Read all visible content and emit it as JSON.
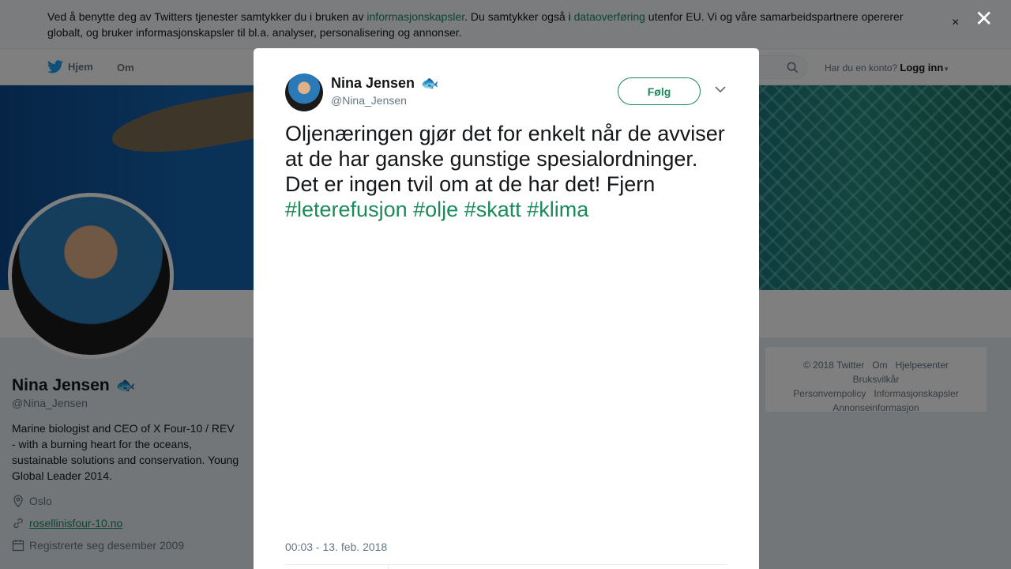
{
  "cookie": {
    "text_1": "Ved å benytte deg av Twitters tjenester samtykker du i bruken av ",
    "link_1": "informasjonskapsler",
    "text_2": ". Du samtykker også i ",
    "link_2": "dataoverføring",
    "text_3": " utenfor EU. Vi og våre samarbeidspartnere opererer globalt, og bruker informasjonskapsler til bl.a. analyser, personalisering og annonser.",
    "close": "×"
  },
  "nav": {
    "home": "Hjem",
    "about": "Om",
    "login_prompt": "Har du en konto?",
    "login": "Logg inn"
  },
  "profile": {
    "name": "Nina Jensen",
    "emoji": "🐟",
    "handle": "@Nina_Jensen",
    "bio": "Marine biologist and CEO of X Four-10 / REV - with a burning heart for the oceans, sustainable solutions and conservation. Young Global Leader 2014.",
    "location": "Oslo",
    "url": "rosellinisfour-10.no",
    "joined": "Registrerte seg desember 2009"
  },
  "footer": {
    "items": [
      "© 2018 Twitter",
      "Om",
      "Hjelpesenter",
      "Bruksvilkår",
      "Personvernpolicy",
      "Informasjonskapsler",
      "Annonseinformasjon"
    ]
  },
  "modal": {
    "close": "✕",
    "name": "Nina Jensen",
    "emoji": "🐟",
    "handle": "@Nina_Jensen",
    "follow": "Følg",
    "tweet_text": "Oljenæringen gjør det for enkelt når de avviser at de har ganske gunstige spesialordninger. Det er ingen tvil om at de har det! Fjern ",
    "hashtags": [
      "#leterefusjon",
      "#olje",
      "#skatt",
      "#klima"
    ],
    "timestamp": "00:03 - 13. feb. 2018"
  },
  "colors": {
    "accent": "#1a8a5a",
    "muted": "#657786",
    "brand_bird": "#1da1f2"
  }
}
